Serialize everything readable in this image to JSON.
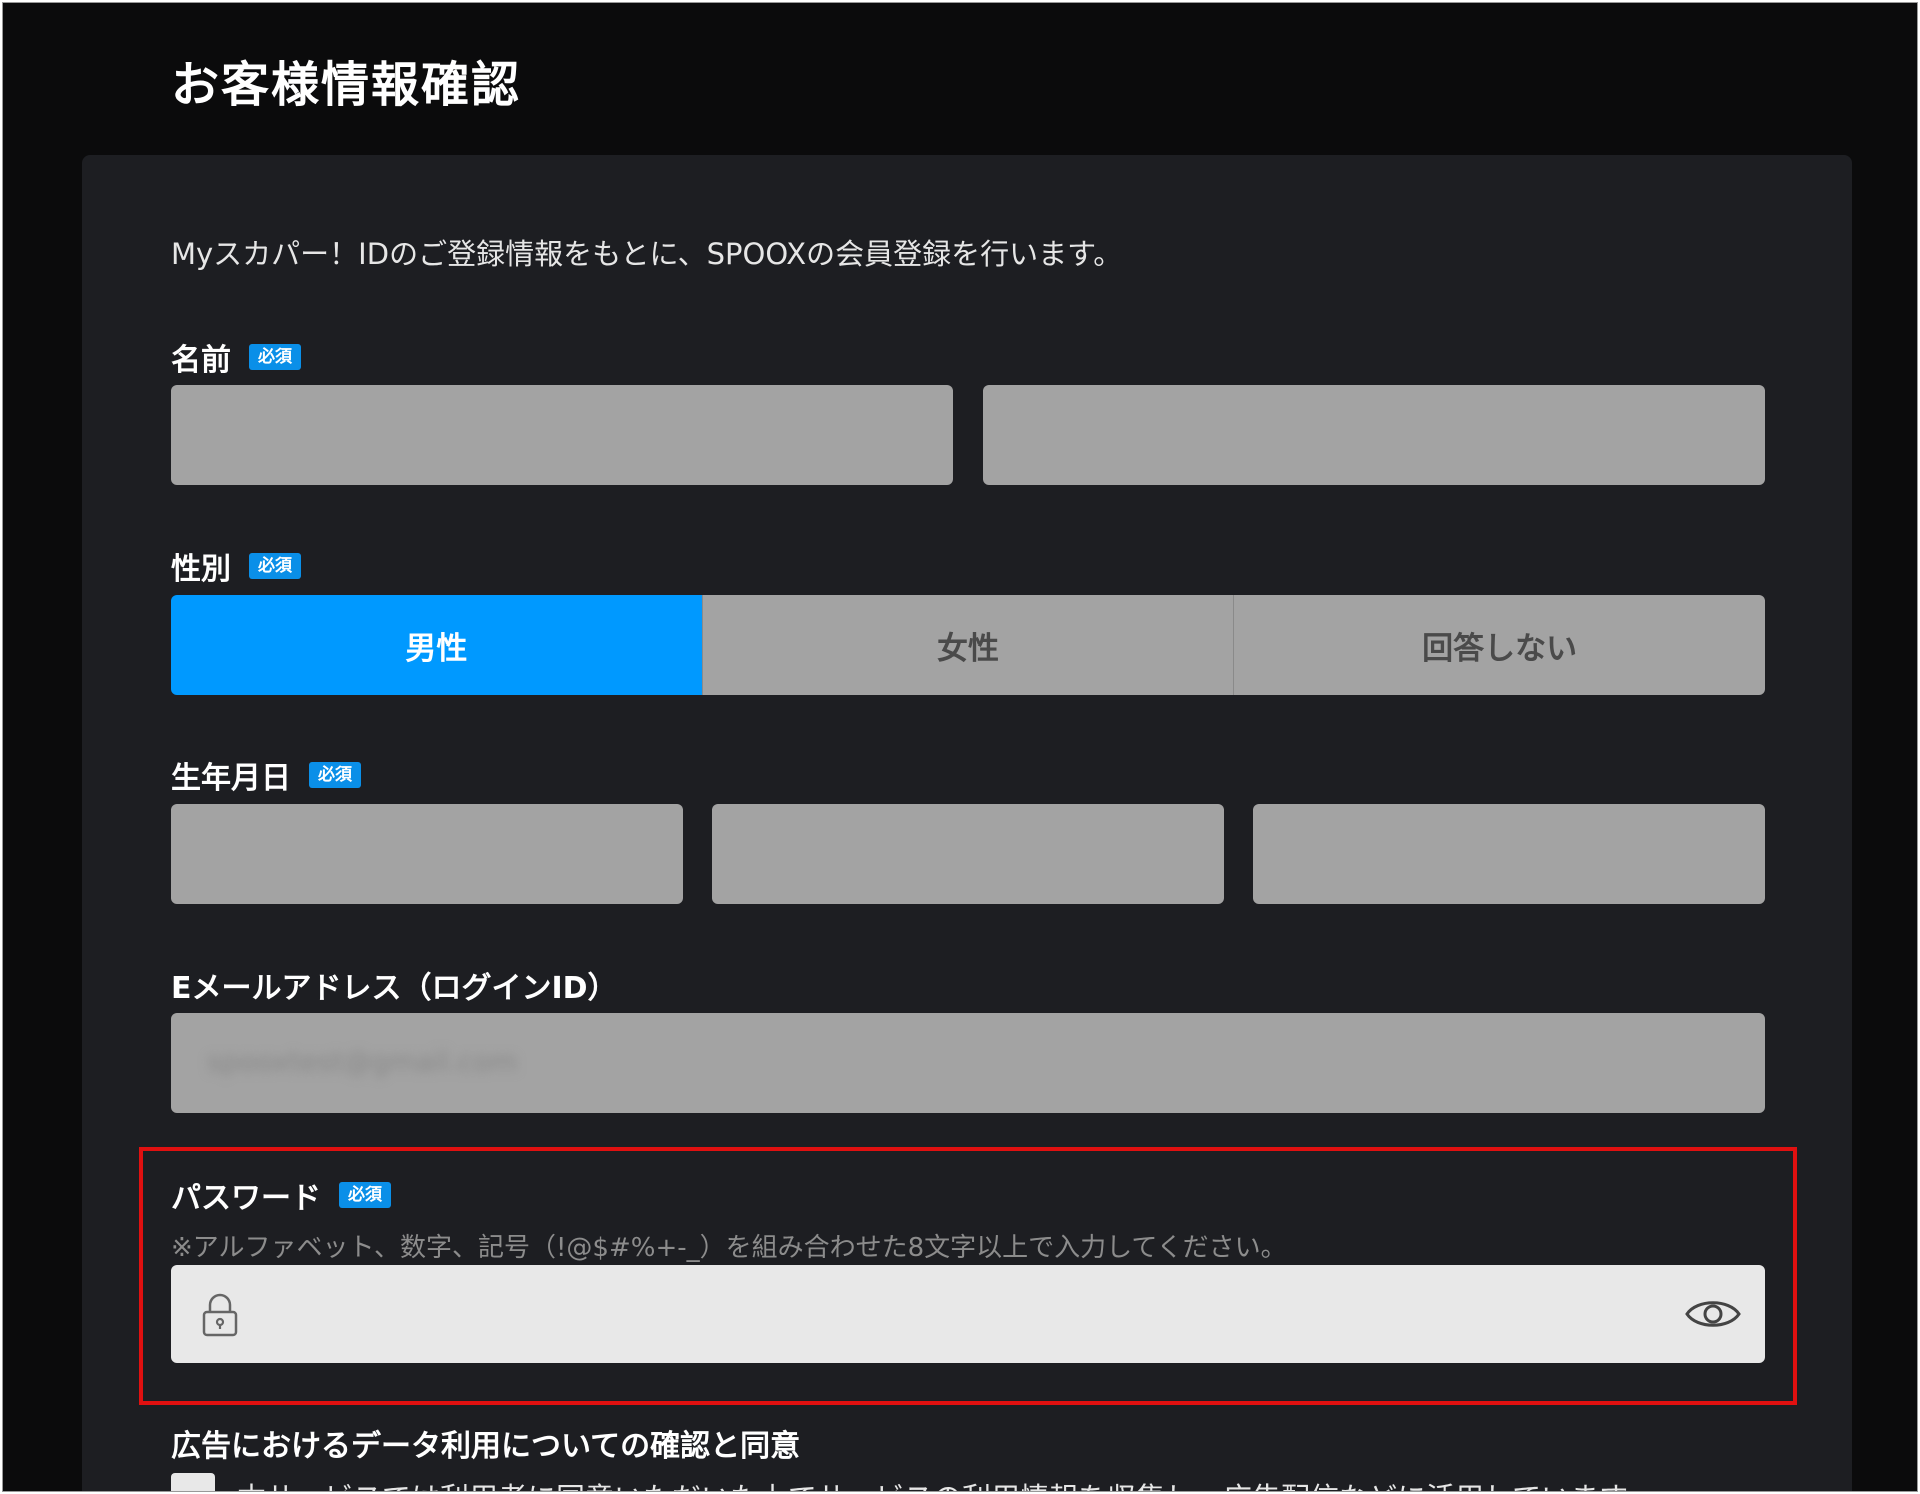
{
  "page": {
    "title": "お客様情報確認",
    "intro": "Myスカパー！IDのご登録情報をもとに、SPOOXの会員登録を行います。"
  },
  "required_badge": "必須",
  "name_field": {
    "label": "名前",
    "last_name_value": "",
    "first_name_value": ""
  },
  "gender_field": {
    "label": "性別",
    "options": [
      "男性",
      "女性",
      "回答しない"
    ],
    "selected": "男性"
  },
  "birthdate_field": {
    "label": "生年月日",
    "year_value": "",
    "month_value": "",
    "day_value": ""
  },
  "email_field": {
    "label": "Eメールアドレス（ログインID）",
    "value": "spooxtest@gmail.com"
  },
  "password_field": {
    "label": "パスワード",
    "hint": "※アルファベット、数字、記号（!@$#%+-_）を組み合わせた8文字以上で入力してください。",
    "value": "",
    "lock_icon": "lock-icon",
    "visibility_icon": "eye-icon"
  },
  "consent": {
    "title": "広告におけるデータ利用についての確認と同意",
    "text": "本サービスでは利用者に同意いただいた上でサービスの利用情報を収集し、広告配信などに活用しています"
  },
  "colors": {
    "background": "#0b0b0c",
    "panel": "#1d1e22",
    "input": "#a3a3a3",
    "accent": "#0099ff",
    "badge": "#0a8fe8",
    "highlight": "#e01010"
  }
}
